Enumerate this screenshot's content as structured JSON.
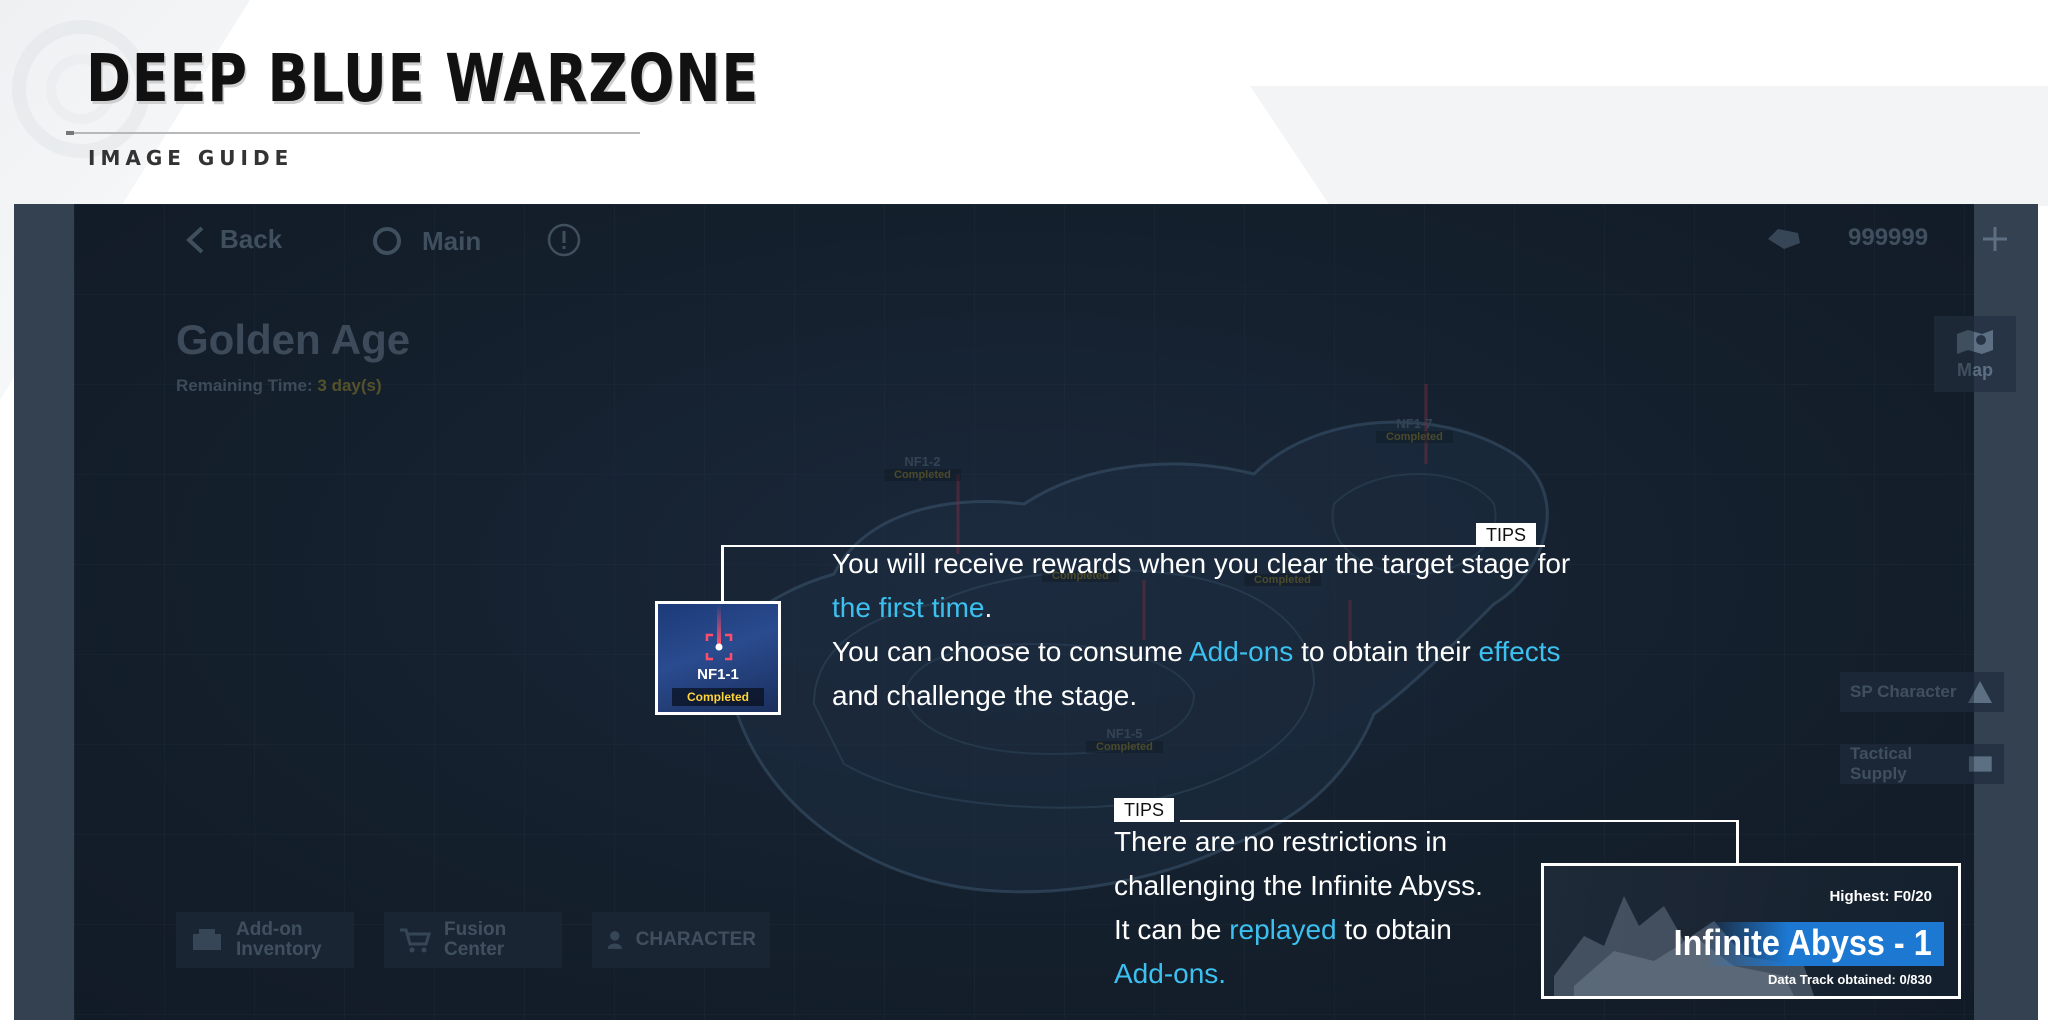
{
  "header": {
    "title": "DEEP BLUE WARZONE",
    "subtitle": "IMAGE GUIDE"
  },
  "game_ui": {
    "nav": {
      "back_label": "Back",
      "main_label": "Main"
    },
    "currency": {
      "value": "999999"
    },
    "event": {
      "title": "Golden Age",
      "remaining_label": "Remaining Time:",
      "remaining_value": "3 day(s)"
    },
    "map_button": {
      "label": "Map"
    },
    "side_buttons": [
      {
        "label": "SP Character"
      },
      {
        "label": "Tactical Supply"
      }
    ],
    "bottom_buttons": [
      {
        "line1": "Add-on",
        "line2": "Inventory"
      },
      {
        "line1": "Fusion",
        "line2": "Center"
      },
      {
        "line1": "CHARACTER",
        "line2": ""
      }
    ],
    "stages": [
      {
        "name": "NF1-2",
        "status": "Completed"
      },
      {
        "name": "NF1-7",
        "status": "Completed"
      },
      {
        "name": "NF1-5",
        "status": "Completed"
      },
      {
        "name": "",
        "status": "Completed"
      },
      {
        "name": "",
        "status": "Completed"
      }
    ],
    "highlight_stage": {
      "name": "NF1-1",
      "status": "Completed"
    },
    "abyss_card": {
      "highest": "Highest: F0/20",
      "title": "Infinite Abyss - 1",
      "track": "Data Track obtained: 0/830"
    }
  },
  "tips": [
    {
      "tag": "TIPS",
      "segments": [
        "You will receive rewards when you clear the target stage for ",
        "the first time",
        ".",
        "You can choose to consume ",
        "Add-ons",
        " to obtain their ",
        "effects",
        "and challenge the stage."
      ]
    },
    {
      "tag": "TIPS",
      "segments": [
        "There are no restrictions in",
        "challenging the Infinite Abyss.",
        "It can be ",
        "replayed",
        " to obtain",
        "Add-ons."
      ]
    }
  ],
  "colors": {
    "highlight": "#3cc0f0",
    "completed": "#ffd33a",
    "abyss_band": "#1d78d2"
  }
}
